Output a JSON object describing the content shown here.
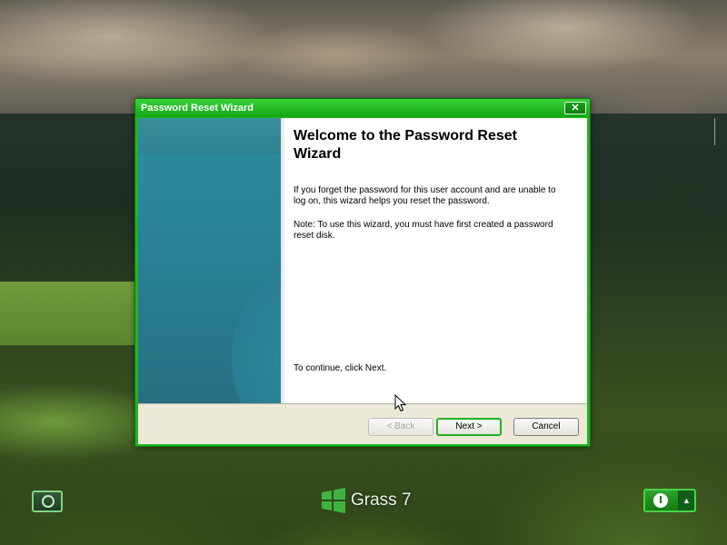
{
  "window": {
    "title": "Password Reset Wizard",
    "close_glyph": "✕",
    "heading": "Welcome to the Password Reset Wizard",
    "paragraph1": "If you forget the password for this user account and are unable to log on, this wizard helps you reset the password.",
    "paragraph2": "Note: To use this wizard, you must have first created a password reset disk.",
    "paragraph3": "To continue, click Next.",
    "buttons": {
      "back": "< Back",
      "next": "Next >",
      "cancel": "Cancel"
    }
  },
  "taskbar": {
    "brand": "Grass 7",
    "power_arrow": "▲"
  },
  "colors": {
    "accent": "#21b521",
    "panel": "#2a8398"
  },
  "icons": [
    "start-orb-icon",
    "windows-logo-icon",
    "power-icon",
    "chevron-up-icon",
    "close-icon",
    "mouse-cursor-icon"
  ]
}
